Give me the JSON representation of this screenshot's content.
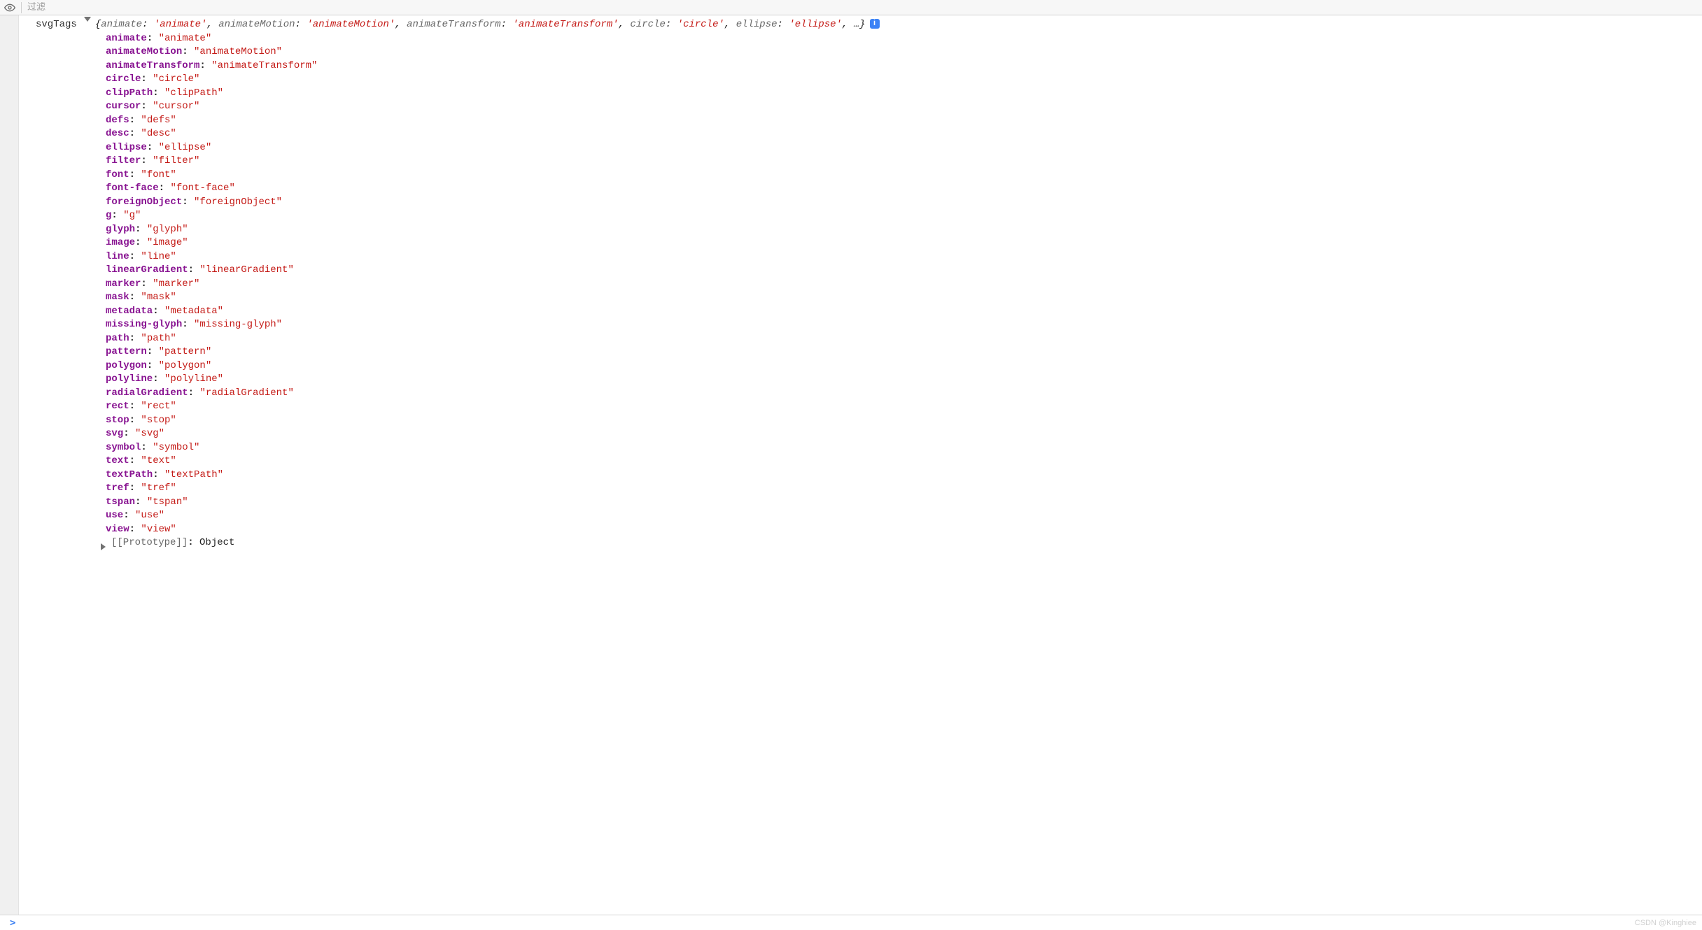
{
  "toolbar": {
    "filter_placeholder": "过滤"
  },
  "variable_name": "svgTags",
  "summary_preview": [
    {
      "key": "animate",
      "value": "'animate'"
    },
    {
      "key": "animateMotion",
      "value": "'animateMotion'"
    },
    {
      "key": "animateTransform",
      "value": "'animateTransform'"
    },
    {
      "key": "circle",
      "value": "'circle'"
    },
    {
      "key": "ellipse",
      "value": "'ellipse'"
    }
  ],
  "summary_ellipsis": "…",
  "info_badge": "i",
  "properties": [
    {
      "key": "animate",
      "value": "\"animate\""
    },
    {
      "key": "animateMotion",
      "value": "\"animateMotion\""
    },
    {
      "key": "animateTransform",
      "value": "\"animateTransform\""
    },
    {
      "key": "circle",
      "value": "\"circle\""
    },
    {
      "key": "clipPath",
      "value": "\"clipPath\""
    },
    {
      "key": "cursor",
      "value": "\"cursor\""
    },
    {
      "key": "defs",
      "value": "\"defs\""
    },
    {
      "key": "desc",
      "value": "\"desc\""
    },
    {
      "key": "ellipse",
      "value": "\"ellipse\""
    },
    {
      "key": "filter",
      "value": "\"filter\""
    },
    {
      "key": "font",
      "value": "\"font\""
    },
    {
      "key": "font-face",
      "value": "\"font-face\""
    },
    {
      "key": "foreignObject",
      "value": "\"foreignObject\""
    },
    {
      "key": "g",
      "value": "\"g\""
    },
    {
      "key": "glyph",
      "value": "\"glyph\""
    },
    {
      "key": "image",
      "value": "\"image\""
    },
    {
      "key": "line",
      "value": "\"line\""
    },
    {
      "key": "linearGradient",
      "value": "\"linearGradient\""
    },
    {
      "key": "marker",
      "value": "\"marker\""
    },
    {
      "key": "mask",
      "value": "\"mask\""
    },
    {
      "key": "metadata",
      "value": "\"metadata\""
    },
    {
      "key": "missing-glyph",
      "value": "\"missing-glyph\""
    },
    {
      "key": "path",
      "value": "\"path\""
    },
    {
      "key": "pattern",
      "value": "\"pattern\""
    },
    {
      "key": "polygon",
      "value": "\"polygon\""
    },
    {
      "key": "polyline",
      "value": "\"polyline\""
    },
    {
      "key": "radialGradient",
      "value": "\"radialGradient\""
    },
    {
      "key": "rect",
      "value": "\"rect\""
    },
    {
      "key": "stop",
      "value": "\"stop\""
    },
    {
      "key": "svg",
      "value": "\"svg\""
    },
    {
      "key": "symbol",
      "value": "\"symbol\""
    },
    {
      "key": "text",
      "value": "\"text\""
    },
    {
      "key": "textPath",
      "value": "\"textPath\""
    },
    {
      "key": "tref",
      "value": "\"tref\""
    },
    {
      "key": "tspan",
      "value": "\"tspan\""
    },
    {
      "key": "use",
      "value": "\"use\""
    },
    {
      "key": "view",
      "value": "\"view\""
    }
  ],
  "prototype": {
    "key": "[[Prototype]]",
    "value": "Object"
  },
  "prompt": ">",
  "watermark": "CSDN @Kinghiee"
}
